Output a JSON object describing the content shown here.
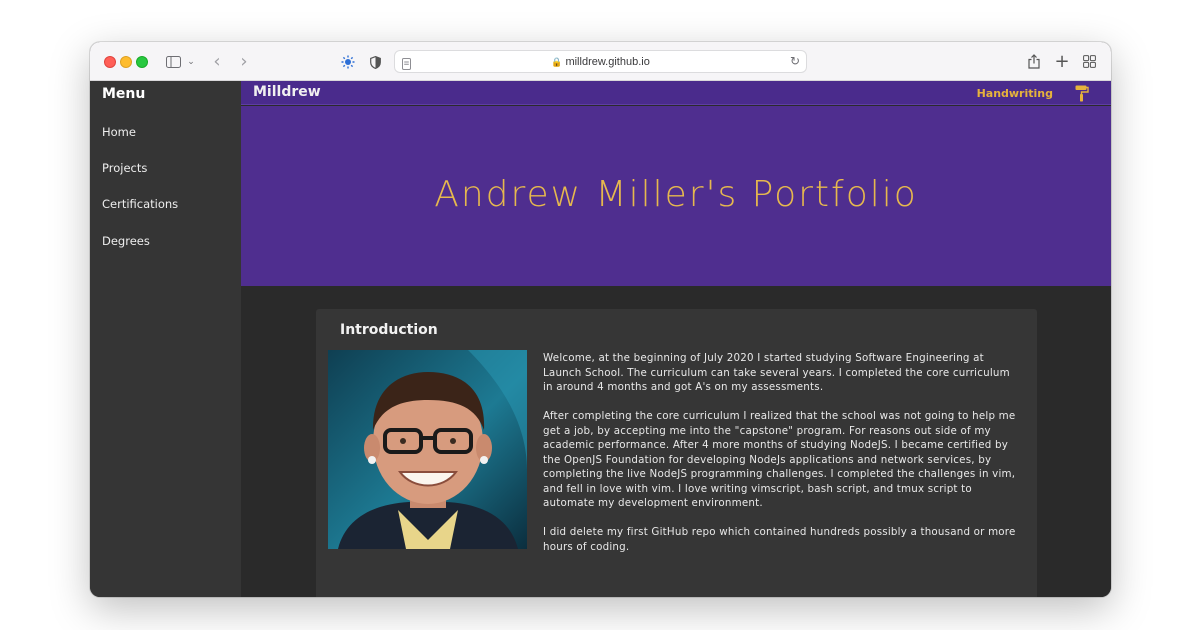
{
  "browser": {
    "url": "milldrew.github.io"
  },
  "sidebar": {
    "title": "Menu",
    "items": [
      {
        "label": "Home"
      },
      {
        "label": "Projects"
      },
      {
        "label": "Certifications"
      },
      {
        "label": "Degrees"
      }
    ]
  },
  "header": {
    "brand": "Milldrew",
    "font_toggle": "Handwriting"
  },
  "hero": {
    "title": "Andrew Miller's Portfolio"
  },
  "intro": {
    "title": "Introduction",
    "paragraphs": [
      "Welcome, at the beginning of July 2020 I started studying Software Engineering at Launch School. The curriculum can take several years. I completed the core curriculum in around 4 months and got A's on my assessments.",
      "After completing the core curriculum I realized that the school was not going to help me get a job, by accepting me into the \"capstone\" program. For reasons out side of my academic performance. After 4 more months of studying NodeJS. I became certified by the OpenJS Foundation for developing NodeJs applications and network services, by completing the live NodeJS programming challenges. I completed the challenges in vim, and fell in love with vim. I love writing vimscript, bash script, and tmux script to automate my development environment.",
      "I did delete my first GitHub repo which contained hundreds possibly a thousand or more hours of coding."
    ]
  },
  "colors": {
    "accent": "#e6b84e",
    "hero_bg": "#4f2e8f",
    "sidebar_bg": "#353535"
  }
}
